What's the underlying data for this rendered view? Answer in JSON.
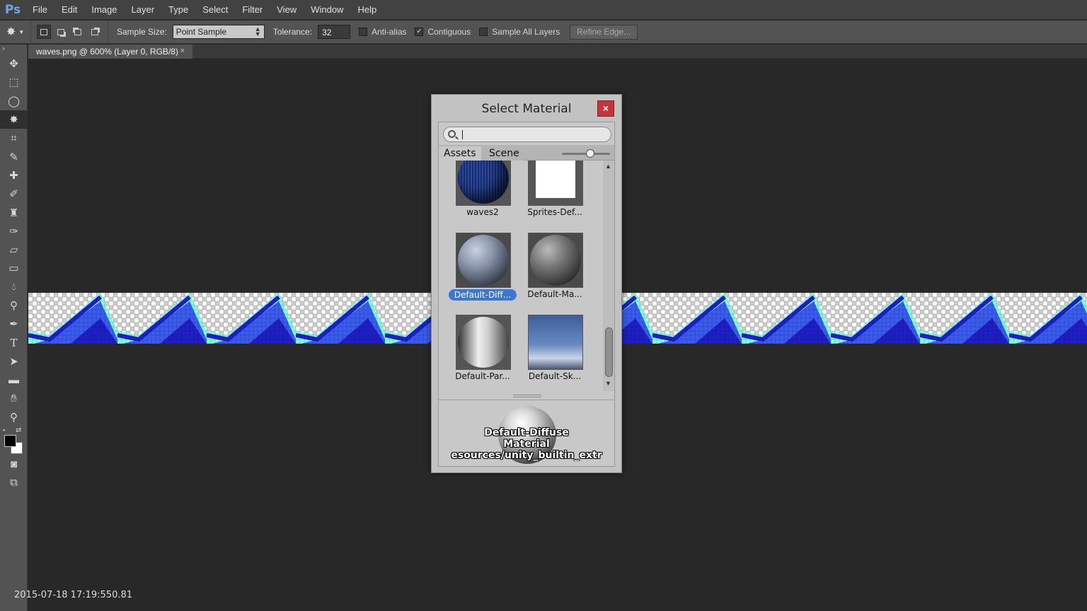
{
  "app": {
    "logo": "Ps"
  },
  "menu": [
    "File",
    "Edit",
    "Image",
    "Layer",
    "Type",
    "Select",
    "Filter",
    "View",
    "Window",
    "Help"
  ],
  "options": {
    "tool_icon": "magic-wand-icon",
    "sample_size_label": "Sample Size:",
    "sample_size_value": "Point Sample",
    "tolerance_label": "Tolerance:",
    "tolerance_value": "32",
    "anti_alias_label": "Anti-alias",
    "anti_alias_checked": false,
    "contiguous_label": "Contiguous",
    "contiguous_checked": true,
    "sample_all_layers_label": "Sample All Layers",
    "sample_all_layers_checked": false,
    "refine_edge_label": "Refine Edge..."
  },
  "tools": [
    "move-icon",
    "marquee-icon",
    "lasso-icon",
    "magic-wand-icon",
    "crop-icon",
    "eyedropper-icon",
    "healing-brush-icon",
    "brush-icon",
    "clone-stamp-icon",
    "history-brush-icon",
    "eraser-icon",
    "gradient-icon",
    "blur-icon",
    "dodge-icon",
    "pen-icon",
    "type-icon",
    "path-selection-icon",
    "rectangle-icon",
    "hand-icon",
    "zoom-icon"
  ],
  "document": {
    "tab_title": "waves.png @ 600% (Layer 0, RGB/8)",
    "close": "×"
  },
  "colors": {
    "pattern_dark": "#1f1fc8",
    "pattern_light": "#7fffe0",
    "pattern_mid": "#3a5cf0"
  },
  "timestamp": "2015-07-18 17:19:550.81",
  "dialog": {
    "title": "Select Material",
    "close": "×",
    "search_placeholder": "",
    "tabs": [
      "Assets",
      "Scene"
    ],
    "items": [
      {
        "name": "waves2",
        "thumb": "blue-sphere"
      },
      {
        "name": "Sprites-Def...",
        "thumb": "white-square"
      },
      {
        "name": "Default-Diff...",
        "thumb": "grey-sphere",
        "selected": true
      },
      {
        "name": "Default-Ma...",
        "thumb": "dark-sphere"
      },
      {
        "name": "Default-Par...",
        "thumb": "particle-sphere"
      },
      {
        "name": "Default-Sk...",
        "thumb": "skybox"
      }
    ],
    "preview": {
      "line1": "Default-Diffuse",
      "line2": "Material",
      "line3": "esources/unity_builtin_extr"
    }
  }
}
